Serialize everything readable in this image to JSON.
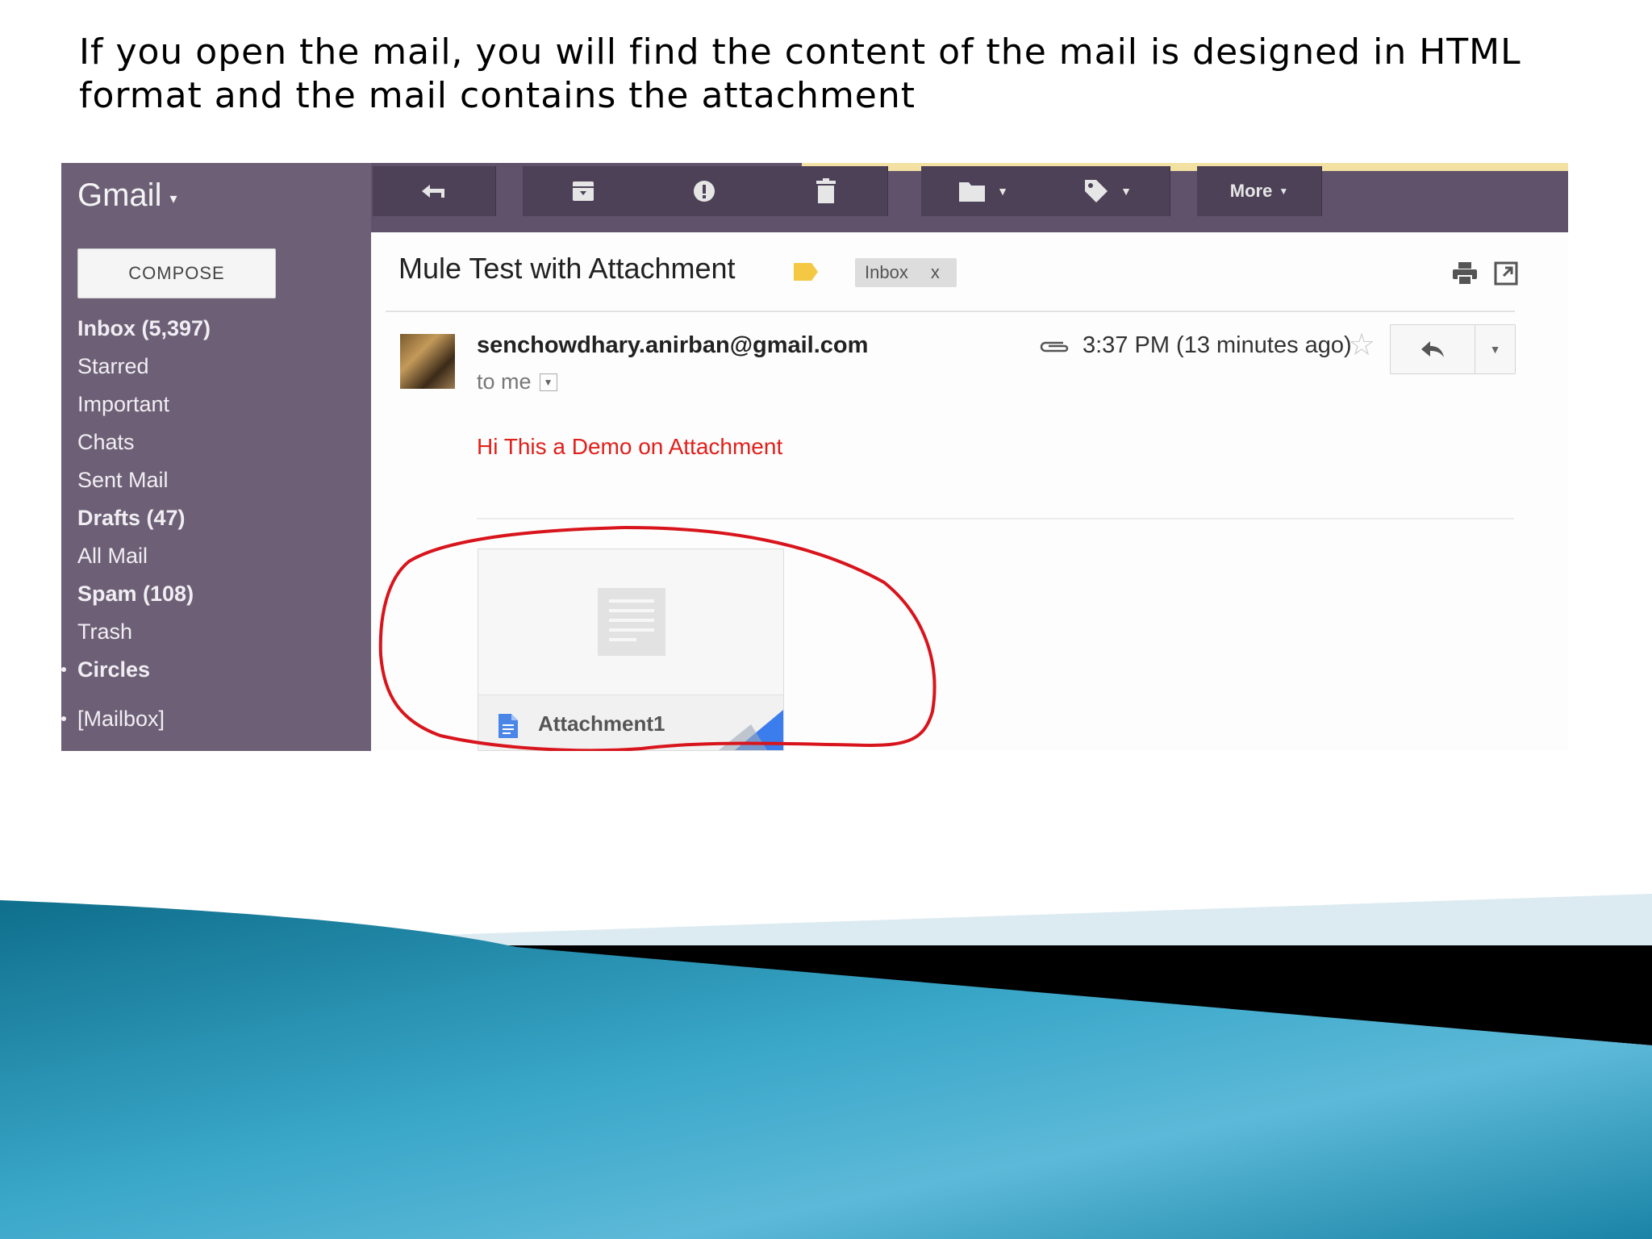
{
  "slide": {
    "caption": "If you open the mail, you will find the content of the mail is designed in HTML format and the mail contains the attachment"
  },
  "app": {
    "brand": "Gmail",
    "toolbar": {
      "more_label": "More"
    },
    "sidebar": {
      "compose_label": "COMPOSE",
      "items": [
        {
          "label": "Inbox (5,397)"
        },
        {
          "label": "Starred"
        },
        {
          "label": "Important"
        },
        {
          "label": "Chats"
        },
        {
          "label": "Sent Mail"
        },
        {
          "label": "Drafts (47)"
        },
        {
          "label": "All Mail"
        },
        {
          "label": "Spam (108)"
        },
        {
          "label": "Trash"
        },
        {
          "label": "Circles"
        },
        {
          "label": "[Mailbox]"
        }
      ]
    },
    "message": {
      "subject": "Mule Test with Attachment",
      "label_chip": "Inbox",
      "label_chip_close": "x",
      "sender": "senchowdhary.anirban@gmail.com",
      "recipient": "to me",
      "time": "3:37 PM (13 minutes ago)",
      "body": "Hi This a Demo on Attachment",
      "attachment_name": "Attachment1"
    }
  },
  "colors": {
    "sidebar": "#6d6076",
    "topbar": "#5f526a",
    "body_text": "#e0201b",
    "annotation": "#d8141c",
    "slide_band": "#1e8fb0"
  }
}
